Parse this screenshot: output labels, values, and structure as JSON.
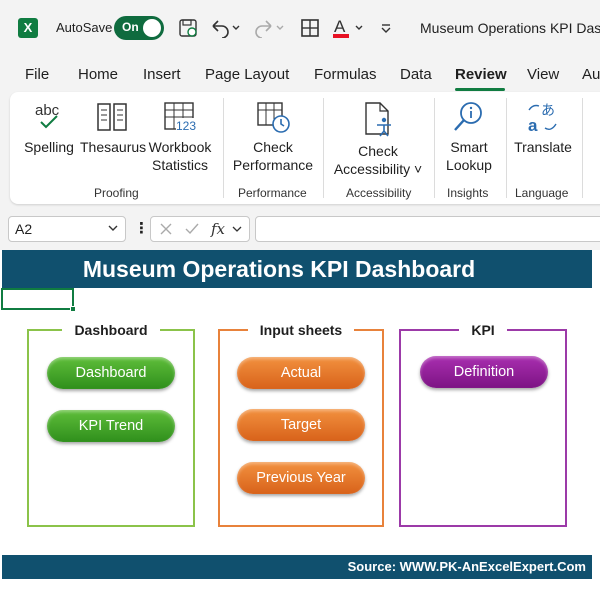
{
  "titlebar": {
    "app_icon_label": "X",
    "autosave_label": "AutoSave",
    "autosave_state": "On",
    "document_title": "Museum Operations KPI Dash",
    "qat_icons": [
      "save-icon",
      "undo-icon",
      "redo-icon",
      "borders-icon",
      "font-color-icon",
      "customize-qat-icon"
    ]
  },
  "tabs": [
    {
      "label": "File"
    },
    {
      "label": "Home"
    },
    {
      "label": "Insert"
    },
    {
      "label": "Page Layout"
    },
    {
      "label": "Formulas"
    },
    {
      "label": "Data"
    },
    {
      "label": "Review",
      "active": true
    },
    {
      "label": "View"
    },
    {
      "label": "Au"
    }
  ],
  "ribbon": {
    "spelling": {
      "label": "Spelling",
      "icon_text": "abc"
    },
    "thesaurus": {
      "label": "Thesaurus"
    },
    "workbook_statistics": {
      "label_line1": "Workbook",
      "label_line2": "Statistics",
      "icon_text": "123"
    },
    "check_performance": {
      "label_line1": "Check",
      "label_line2": "Performance"
    },
    "check_accessibility": {
      "label_line1": "Check",
      "label_line2": "Accessibility ˅"
    },
    "smart_lookup": {
      "label_line1": "Smart",
      "label_line2": "Lookup"
    },
    "translate": {
      "label": "Translate"
    },
    "groups": {
      "proofing": "Proofing",
      "performance": "Performance",
      "accessibility": "Accessibility",
      "insights": "Insights",
      "language": "Language"
    },
    "accent_color": "#107c41"
  },
  "formula_bar": {
    "name_box": "A2",
    "formula_value": ""
  },
  "sheet": {
    "title": "Museum Operations KPI Dashboard",
    "source": "Source: WWW.PK-AnExcelExpert.Com",
    "banner_color": "#10506e",
    "panels": [
      {
        "title": "Dashboard",
        "border_color": "#8bc34a",
        "buttons": [
          "Dashboard",
          "KPI Trend"
        ]
      },
      {
        "title": "Input sheets",
        "border_color": "#e8823b",
        "buttons": [
          "Actual",
          "Target",
          "Previous Year"
        ]
      },
      {
        "title": "KPI",
        "border_color": "#9c3aa8",
        "buttons": [
          "Definition"
        ]
      }
    ]
  }
}
